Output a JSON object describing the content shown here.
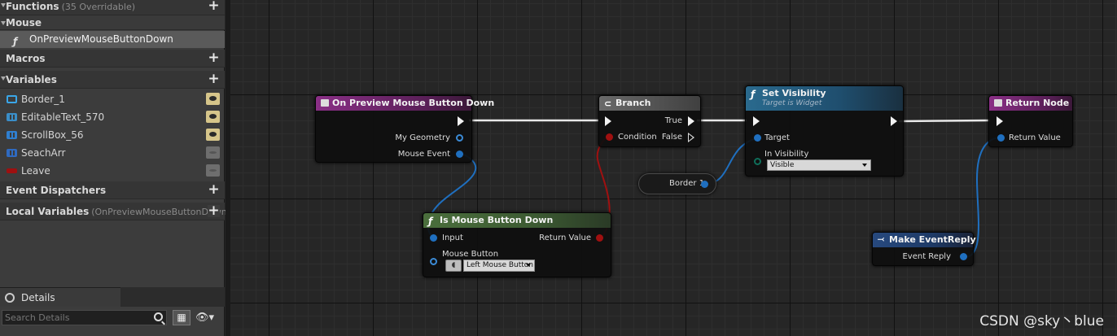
{
  "panel": {
    "functions": {
      "label": "Functions",
      "sub": "(35 Overridable)"
    },
    "mouse_category": "Mouse",
    "function_item": "OnPreviewMouseButtonDown",
    "macros": "Macros",
    "variables": {
      "label": "Variables",
      "items": [
        {
          "name": "Border_1",
          "visible": true,
          "color": "#3aa6e8"
        },
        {
          "name": "EditableText_570",
          "visible": true,
          "color": "#3a8ec8"
        },
        {
          "name": "ScrollBox_56",
          "visible": true,
          "color": "#2f7fd0"
        },
        {
          "name": "SeachArr",
          "visible": false,
          "color": "#2f6ac0"
        },
        {
          "name": "Leave",
          "visible": false,
          "color": "#9e1010"
        }
      ]
    },
    "event_dispatchers": "Event Dispatchers",
    "local_variables": {
      "label": "Local Variables",
      "sub": "(OnPreviewMouseButtonDown"
    }
  },
  "details": {
    "tab_label": "Details",
    "search_placeholder": "Search Details"
  },
  "nodes": {
    "event": {
      "title": "On Preview Mouse Button Down",
      "pins": [
        "My Geometry",
        "Mouse Event"
      ],
      "color": "#7d2a7a"
    },
    "branch": {
      "title": "Branch",
      "pins": {
        "condition": "Condition",
        "true": "True",
        "false": "False"
      },
      "color": "#5c5c5c"
    },
    "set_visibility": {
      "title": "Set Visibility",
      "subtitle": "Target is Widget",
      "pins": {
        "target": "Target",
        "in_visibility": "In Visibility"
      },
      "dropdown": "Visible",
      "color": "#1f4e6e"
    },
    "return": {
      "title": "Return Node",
      "pin": "Return Value",
      "color": "#7d2a7a"
    },
    "border_var": {
      "label": "Border 1"
    },
    "is_mouse_down": {
      "title": "Is Mouse Button Down",
      "pins": {
        "input": "Input",
        "mouse_button": "Mouse Button",
        "return": "Return Value"
      },
      "dropdown": "Left Mouse Button",
      "color": "#3c5a32"
    },
    "make_reply": {
      "title": "Make EventReply",
      "pin": "Event Reply",
      "color": "#1e3a66"
    }
  },
  "watermark": "CSDN @sky丶blue"
}
